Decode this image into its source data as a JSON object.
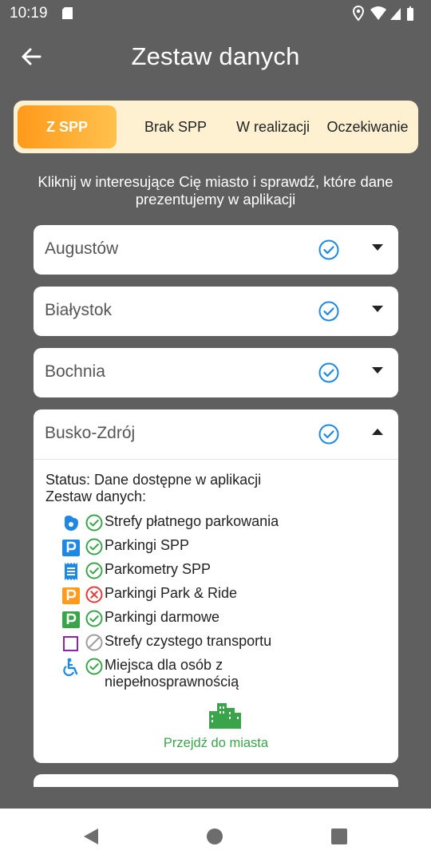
{
  "status_bar": {
    "time": "10:19"
  },
  "app_bar": {
    "title": "Zestaw danych"
  },
  "tabs": [
    {
      "label": "Z SPP",
      "active": true
    },
    {
      "label": "Brak SPP",
      "active": false
    },
    {
      "label": "W realizacji",
      "active": false
    },
    {
      "label": "Oczekiwanie",
      "active": false
    }
  ],
  "intro_text": "Kliknij w interesujące Cię miasto i sprawdź, które dane prezentujemy w aplikacji",
  "cities": [
    {
      "name": "Augustów",
      "status_icon": "check-circle-icon",
      "expanded": false
    },
    {
      "name": "Białystok",
      "status_icon": "check-circle-icon",
      "expanded": false
    },
    {
      "name": "Bochnia",
      "status_icon": "check-circle-icon",
      "expanded": false
    },
    {
      "name": "Busko-Zdrój",
      "status_icon": "check-circle-icon",
      "expanded": true
    }
  ],
  "expanded_city": {
    "status": "Status: Dane dostępne w aplikacji",
    "dataset_label": "Zestaw danych:",
    "datasets": [
      {
        "icon": "paid-zone-icon",
        "status": "available",
        "label": "Strefy płatnego parkowania"
      },
      {
        "icon": "parking-spp-icon",
        "status": "available",
        "label": "Parkingi SPP"
      },
      {
        "icon": "parking-meter-icon",
        "status": "available",
        "label": "Parkometry SPP"
      },
      {
        "icon": "park-and-ride-icon",
        "status": "unavailable",
        "label": "Parkingi Park & Ride"
      },
      {
        "icon": "free-parking-icon",
        "status": "available",
        "label": "Parkingi darmowe"
      },
      {
        "icon": "clean-transport-zone-icon",
        "status": "not-applicable",
        "label": "Strefy czystego transportu"
      },
      {
        "icon": "accessible-icon",
        "status": "available",
        "label": "Miejsca dla osób z",
        "label_line2": "niepełnosprawnością"
      }
    ],
    "go_to_city": "Przejdź do miasta"
  },
  "colors": {
    "background": "#5f5f5f",
    "accent_orange": "#ff9a1a",
    "tab_bar_bg": "#fdf1d2",
    "check_blue": "#1e88e5",
    "ok_green": "#3aa44a",
    "error_red": "#e53935",
    "link_green": "#3aa44a"
  }
}
